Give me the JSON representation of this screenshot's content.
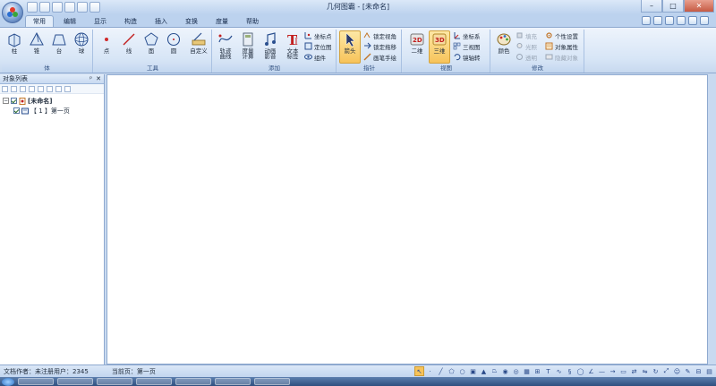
{
  "window": {
    "title": "几何图霸 - [未命名]",
    "minimize": "–",
    "maximize": "□",
    "close": "✕"
  },
  "tabs": [
    "常用",
    "编辑",
    "显示",
    "构造",
    "插入",
    "变换",
    "度量",
    "帮助"
  ],
  "active_tab": "常用",
  "ribbon": {
    "solid_group": {
      "label": "体",
      "buttons": [
        "柱",
        "锥",
        "台",
        "球"
      ]
    },
    "tools_group": {
      "label": "工具",
      "buttons": [
        "点",
        "线",
        "面",
        "圆",
        "自定义"
      ]
    },
    "add_group": {
      "label": "添加",
      "big_buttons": [
        "轨迹\n曲线",
        "度量\n计算",
        "动画\n影音",
        "文本\n标签"
      ],
      "small_buttons": [
        "坐标点",
        "定位图",
        "组件"
      ]
    },
    "pointer_group": {
      "label": "指针",
      "big_button": "箭头",
      "small_buttons": [
        "锁定视角",
        "锁定拖移",
        "画笔手绘"
      ]
    },
    "view_group": {
      "label": "视图",
      "big_buttons": [
        "二维",
        "三维"
      ],
      "small_buttons": [
        "坐标系",
        "三视图",
        "镜轴转"
      ]
    },
    "modify_group": {
      "label": "修改",
      "big_button": "颜色",
      "small_buttons_disabled": [
        "填充",
        "光照",
        "透明"
      ],
      "small_buttons": [
        "个性设置",
        "对象属性"
      ],
      "small_buttons_disabled_2": [
        "隐藏对象"
      ]
    }
  },
  "sidebar": {
    "title": "对象列表",
    "pin": "ᵖ",
    "close": "✕",
    "tree": {
      "root": "[未命名]",
      "child": "【 1 】第一页"
    }
  },
  "status": {
    "author": "文档作者：未注册用户：2345",
    "page": "当前页：第一页"
  },
  "draw_tools": [
    "pointer-arrow",
    "point",
    "line",
    "polygon",
    "circle",
    "cube",
    "cone",
    "frustum",
    "sphere",
    "torus",
    "grid",
    "measure",
    "text",
    "curve",
    "bezier",
    "ellipse",
    "angle",
    "segment",
    "vector",
    "area",
    "transform",
    "mirror",
    "rotate",
    "scale",
    "smile",
    "paint",
    "slider",
    "palette"
  ],
  "colors": {
    "accent": "#f7c35a",
    "ribbon_top": "#eef4fc",
    "frame": "#8ea9cf"
  }
}
